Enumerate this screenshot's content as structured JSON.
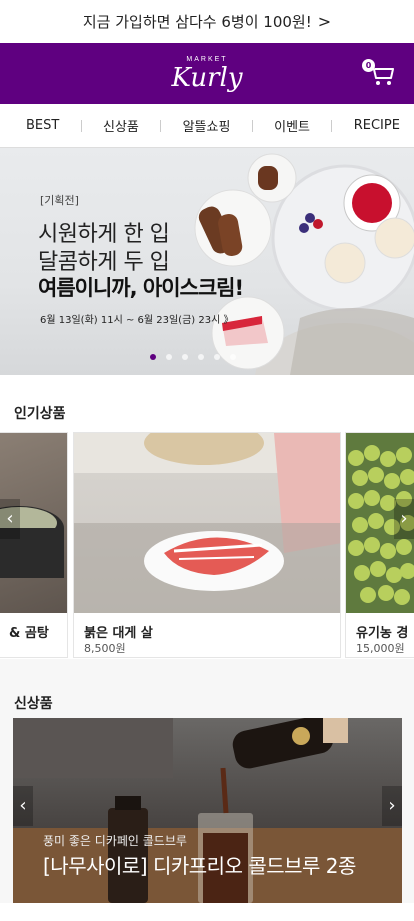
{
  "promo_bar": {
    "text": "지금 가입하면 삼다수 6병이 100원!",
    "chevron": ">"
  },
  "header": {
    "logo_top": "MARKET",
    "logo_main": "Kurly",
    "cart_count": "0",
    "bg_color": "#5f0080"
  },
  "nav": {
    "items": [
      {
        "label": "BEST"
      },
      {
        "label": "신상품"
      },
      {
        "label": "알뜰쇼핑"
      },
      {
        "label": "이벤트"
      },
      {
        "label": "RECIPE"
      }
    ]
  },
  "hero": {
    "tag": "[기획전]",
    "line1": "시원하게 한 입",
    "line2": "달콤하게 두 입",
    "line3": "여름이니까, 아이스크림!",
    "date": "6월 13일(화) 11시 ~ 6월 23일(금) 23시  》",
    "dots": 6,
    "active_dot": 1
  },
  "popular": {
    "title": "인기상품",
    "products": [
      {
        "name": "& 곰탕",
        "price": ""
      },
      {
        "name": "붉은 대게 살",
        "price": "8,500원"
      },
      {
        "name": "유기농 경",
        "price": "15,000원"
      }
    ]
  },
  "new_products": {
    "title": "신상품",
    "banner_sub": "풍미 좋은 디카페인 콜드브루",
    "banner_main": "[나무사이로] 디카프리오 콜드브루 2종"
  }
}
